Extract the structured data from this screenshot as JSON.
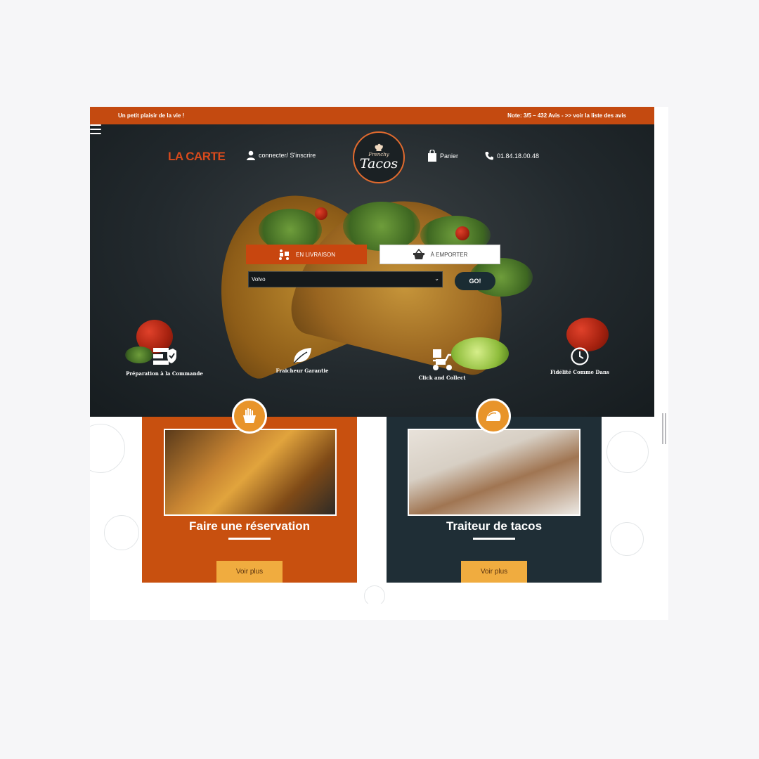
{
  "topbar": {
    "left_text": "Un petit plaisir de la vie !",
    "right_text": "Note: 3/5 – 432 Avis - >> voir la liste des avis"
  },
  "nav": {
    "carte_label": "LA CARTE",
    "account_label": "connecter/ S'inscrire",
    "cart_label": "Panier",
    "phone": "01.84.18.00.48",
    "menu_icon": "hamburger-icon"
  },
  "logo": {
    "small_text": "Frenchy",
    "big_text": "Tacos"
  },
  "order": {
    "delivery_label": "EN LIVRAISON",
    "takeaway_label": "À EMPORTER",
    "city_value": "Volvo",
    "go_label": "GO!"
  },
  "features": [
    {
      "label": "Préparation à la Commande",
      "icon": "checklist-icon"
    },
    {
      "label": "Fraicheur Garantie",
      "icon": "leaf-icon"
    },
    {
      "label": "Click and Collect",
      "icon": "scooter-icon"
    },
    {
      "label": "Fidélité Comme Dans",
      "icon": "clock-icon"
    }
  ],
  "cards": [
    {
      "title": "Faire une réservation",
      "button": "Voir plus",
      "icon": "fries-icon"
    },
    {
      "title": "Traiteur de tacos",
      "button": "Voir plus",
      "icon": "taco-icon"
    }
  ],
  "colors": {
    "brand_orange": "#c8500f",
    "accent_yellow": "#f0ac3f",
    "dark_navy": "#1f2e36",
    "hero_bg": "#22292d"
  }
}
